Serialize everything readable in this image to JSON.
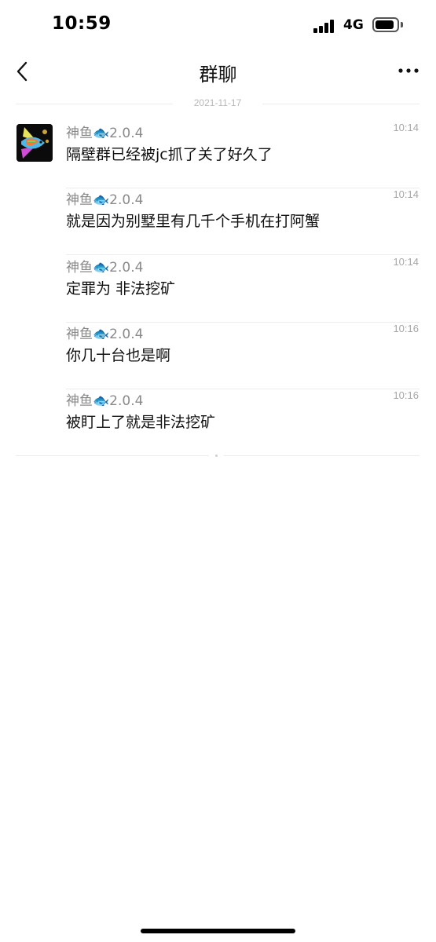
{
  "status_bar": {
    "time": "10:59",
    "network": "4G",
    "battery_level": 0.9,
    "signal_bars": 4
  },
  "nav": {
    "title": "群聊",
    "back_icon": "chevron-left-icon",
    "more_icon": "more-dots-icon"
  },
  "chat": {
    "date": "2021-11-17",
    "messages": [
      {
        "sender": "神鱼🐟2.0.4",
        "time": "10:14",
        "text": "隔壁群已经被jc抓了关了好久了"
      },
      {
        "sender": "神鱼🐟2.0.4",
        "time": "10:14",
        "text": "就是因为别墅里有几千个手机在打阿蟹"
      },
      {
        "sender": "神鱼🐟2.0.4",
        "time": "10:14",
        "text": "定罪为 非法挖矿"
      },
      {
        "sender": "神鱼🐟2.0.4",
        "time": "10:16",
        "text": "你几十台也是啊"
      },
      {
        "sender": "神鱼🐟2.0.4",
        "time": "10:16",
        "text": "被盯上了就是非法挖矿"
      }
    ]
  },
  "colors": {
    "text_primary": "#111111",
    "text_secondary": "#8a8a8a",
    "divider": "#ececec",
    "background": "#ffffff"
  }
}
